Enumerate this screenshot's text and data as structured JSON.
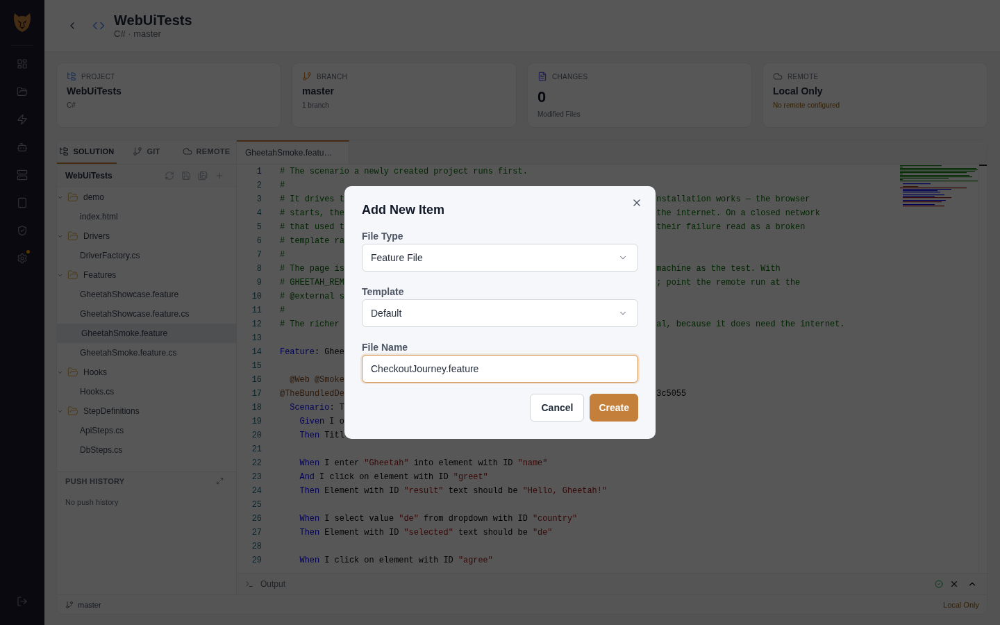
{
  "nav": {
    "items": [
      {
        "alert": false
      },
      {
        "alert": false
      },
      {
        "alert": false
      },
      {
        "alert": false
      },
      {
        "alert": false
      },
      {
        "alert": false
      },
      {
        "alert": false
      },
      {
        "alert": true
      }
    ]
  },
  "header": {
    "title": "WebUiTests",
    "subtitle": "C# · master"
  },
  "stats": [
    {
      "kind": "project",
      "label": "PROJECT",
      "value": "WebUiTests",
      "note": "C#"
    },
    {
      "kind": "branch",
      "label": "BRANCH",
      "value": "master",
      "note": "1 branch"
    },
    {
      "kind": "changes",
      "label": "CHANGES",
      "value": "0",
      "note": "Modified Files"
    },
    {
      "kind": "remote",
      "label": "REMOTE",
      "value": "Local Only",
      "note": "No remote configured"
    }
  ],
  "panel_tabs": [
    {
      "label": "SOLUTION",
      "selected": true
    },
    {
      "label": "GIT",
      "selected": false
    },
    {
      "label": "REMOTE",
      "selected": false
    }
  ],
  "solution": {
    "title": "WebUiTests",
    "tree": [
      {
        "kind": "folder",
        "label": "demo",
        "expanded": true,
        "selected": false,
        "children": [
          {
            "kind": "file",
            "label": "index.html",
            "selected": false
          }
        ]
      },
      {
        "kind": "folder",
        "label": "Drivers",
        "expanded": true,
        "selected": false,
        "children": [
          {
            "kind": "file",
            "label": "DriverFactory.cs",
            "selected": false
          }
        ]
      },
      {
        "kind": "folder",
        "label": "Features",
        "expanded": true,
        "selected": false,
        "children": [
          {
            "kind": "file",
            "label": "GheetahShowcase.feature",
            "selected": false
          },
          {
            "kind": "file",
            "label": "GheetahShowcase.feature.cs",
            "selected": false
          },
          {
            "kind": "file",
            "label": "GheetahSmoke.feature",
            "selected": true
          },
          {
            "kind": "file",
            "label": "GheetahSmoke.feature.cs",
            "selected": false
          }
        ]
      },
      {
        "kind": "folder",
        "label": "Hooks",
        "expanded": true,
        "selected": false,
        "children": [
          {
            "kind": "file",
            "label": "Hooks.cs",
            "selected": false
          }
        ]
      },
      {
        "kind": "folder",
        "label": "StepDefinitions",
        "expanded": true,
        "selected": false,
        "children": [
          {
            "kind": "file",
            "label": "ApiSteps.cs",
            "selected": false
          },
          {
            "kind": "file",
            "label": "DbSteps.cs",
            "selected": false
          }
        ]
      }
    ]
  },
  "push_history": {
    "title": "PUSH HISTORY",
    "empty": "No push history"
  },
  "editor": {
    "tabs": [
      {
        "label": "GheetahSmoke.featu…",
        "selected": true
      }
    ],
    "lines": [
      {
        "number": "1",
        "current": true,
        "code": [
          {
            "text": "# The scenario a newly created project runs first.",
            "kind": "comment"
          }
        ]
      },
      {
        "number": "2",
        "current": false,
        "code": [
          {
            "text": "#",
            "kind": "comment"
          }
        ]
      },
      {
        "number": "3",
        "current": false,
        "code": [
          {
            "text": "# It drives t",
            "kind": "comment"
          }
        ],
        "rest": [
          {
            "text": "nstallation works — the browser",
            "kind": "comment"
          }
        ]
      },
      {
        "number": "4",
        "current": false,
        "code": [
          {
            "text": "# starts, the",
            "kind": "comment"
          }
        ],
        "rest": [
          {
            "text": "the internet. On a closed network",
            "kind": "comment"
          }
        ]
      },
      {
        "number": "5",
        "current": false,
        "code": [
          {
            "text": "# that used t",
            "kind": "comment"
          }
        ],
        "rest": [
          {
            "text": "their failure read as a broken",
            "kind": "comment"
          }
        ]
      },
      {
        "number": "6",
        "current": false,
        "code": [
          {
            "text": "# template ra",
            "kind": "comment"
          }
        ]
      },
      {
        "number": "7",
        "current": false,
        "code": [
          {
            "text": "#",
            "kind": "comment"
          }
        ]
      },
      {
        "number": "8",
        "current": false,
        "code": [
          {
            "text": "# The page is",
            "kind": "comment"
          }
        ],
        "rest": [
          {
            "text": "machine as the test. With",
            "kind": "comment"
          }
        ]
      },
      {
        "number": "9",
        "current": false,
        "code": [
          {
            "text": "# GHEETAH_REM",
            "kind": "comment"
          }
        ],
        "rest": [
          {
            "text": "; point the remote run at the",
            "kind": "comment"
          }
        ]
      },
      {
        "number": "10",
        "current": false,
        "code": [
          {
            "text": "# @external s",
            "kind": "comment"
          }
        ]
      },
      {
        "number": "11",
        "current": false,
        "code": [
          {
            "text": "#",
            "kind": "comment"
          }
        ]
      },
      {
        "number": "12",
        "current": false,
        "code": [
          {
            "text": "# The richer",
            "kind": "comment"
          }
        ],
        "rest": [
          {
            "text": "al, because it does need the internet.",
            "kind": "comment"
          }
        ]
      },
      {
        "number": "13",
        "current": false
      },
      {
        "number": "14",
        "current": false,
        "code": [
          {
            "text": "Feature",
            "kind": "keyword"
          },
          {
            "text": ": Ghee",
            "kind": "plain"
          }
        ]
      },
      {
        "number": "15",
        "current": false
      },
      {
        "number": "16",
        "current": false,
        "code": [
          {
            "text": "  @Web @Smoke",
            "kind": "tag"
          }
        ]
      },
      {
        "number": "17",
        "current": false,
        "code": [
          {
            "text": "@TheBundledDe",
            "kind": "tag"
          }
        ],
        "rest": [
          {
            "text": "3c5055",
            "kind": "plain"
          }
        ]
      },
      {
        "number": "18",
        "current": false,
        "code": [
          {
            "text": "  Scenario",
            "kind": "keyword"
          },
          {
            "text": ": T",
            "kind": "plain"
          }
        ]
      },
      {
        "number": "19",
        "current": false,
        "code": [
          {
            "text": "    Given",
            "kind": "keyword"
          },
          {
            "text": " I o",
            "kind": "plain"
          }
        ]
      },
      {
        "number": "20",
        "current": false,
        "code": [
          {
            "text": "    Then",
            "kind": "keyword"
          },
          {
            "text": " Titl",
            "kind": "plain"
          }
        ]
      },
      {
        "number": "21",
        "current": false
      },
      {
        "number": "22",
        "current": false,
        "code": [
          {
            "text": "    When",
            "kind": "keyword"
          },
          {
            "text": " I enter ",
            "kind": "plain"
          },
          {
            "text": "\"Gheetah\"",
            "kind": "string"
          },
          {
            "text": " into element with ID ",
            "kind": "plain"
          },
          {
            "text": "\"name\"",
            "kind": "string"
          }
        ]
      },
      {
        "number": "23",
        "current": false,
        "code": [
          {
            "text": "    And",
            "kind": "keyword"
          },
          {
            "text": " I click on element with ID ",
            "kind": "plain"
          },
          {
            "text": "\"greet\"",
            "kind": "string"
          }
        ]
      },
      {
        "number": "24",
        "current": false,
        "code": [
          {
            "text": "    Then",
            "kind": "keyword"
          },
          {
            "text": " Element with ID ",
            "kind": "plain"
          },
          {
            "text": "\"result\"",
            "kind": "string"
          },
          {
            "text": " text should be ",
            "kind": "plain"
          },
          {
            "text": "\"Hello, Gheetah!\"",
            "kind": "string"
          }
        ]
      },
      {
        "number": "25",
        "current": false
      },
      {
        "number": "26",
        "current": false,
        "code": [
          {
            "text": "    When",
            "kind": "keyword"
          },
          {
            "text": " I select value ",
            "kind": "plain"
          },
          {
            "text": "\"de\"",
            "kind": "string"
          },
          {
            "text": " from dropdown with ID ",
            "kind": "plain"
          },
          {
            "text": "\"country\"",
            "kind": "string"
          }
        ]
      },
      {
        "number": "27",
        "current": false,
        "code": [
          {
            "text": "    Then",
            "kind": "keyword"
          },
          {
            "text": " Element with ID ",
            "kind": "plain"
          },
          {
            "text": "\"selected\"",
            "kind": "string"
          },
          {
            "text": " text should be ",
            "kind": "plain"
          },
          {
            "text": "\"de\"",
            "kind": "string"
          }
        ]
      },
      {
        "number": "28",
        "current": false
      },
      {
        "number": "29",
        "current": false,
        "code": [
          {
            "text": "    When",
            "kind": "keyword"
          },
          {
            "text": " I click on element with ID ",
            "kind": "plain"
          },
          {
            "text": "\"agree\"",
            "kind": "string"
          }
        ]
      }
    ]
  },
  "output": {
    "label": "Output"
  },
  "status_bar": {
    "branch": "master",
    "remote": "Local Only"
  },
  "dialog": {
    "title": "Add New Item",
    "fields": [
      {
        "kind": "select",
        "label": "File Type",
        "value": "Feature File",
        "focused": false
      },
      {
        "kind": "select",
        "label": "Template",
        "value": "Default",
        "focused": false
      },
      {
        "kind": "text",
        "label": "File Name",
        "value": "CheckoutJourney.feature",
        "focused": true
      }
    ],
    "buttons": [
      {
        "kind": "secondary",
        "label": "Cancel"
      },
      {
        "kind": "primary",
        "label": "Create"
      }
    ]
  }
}
